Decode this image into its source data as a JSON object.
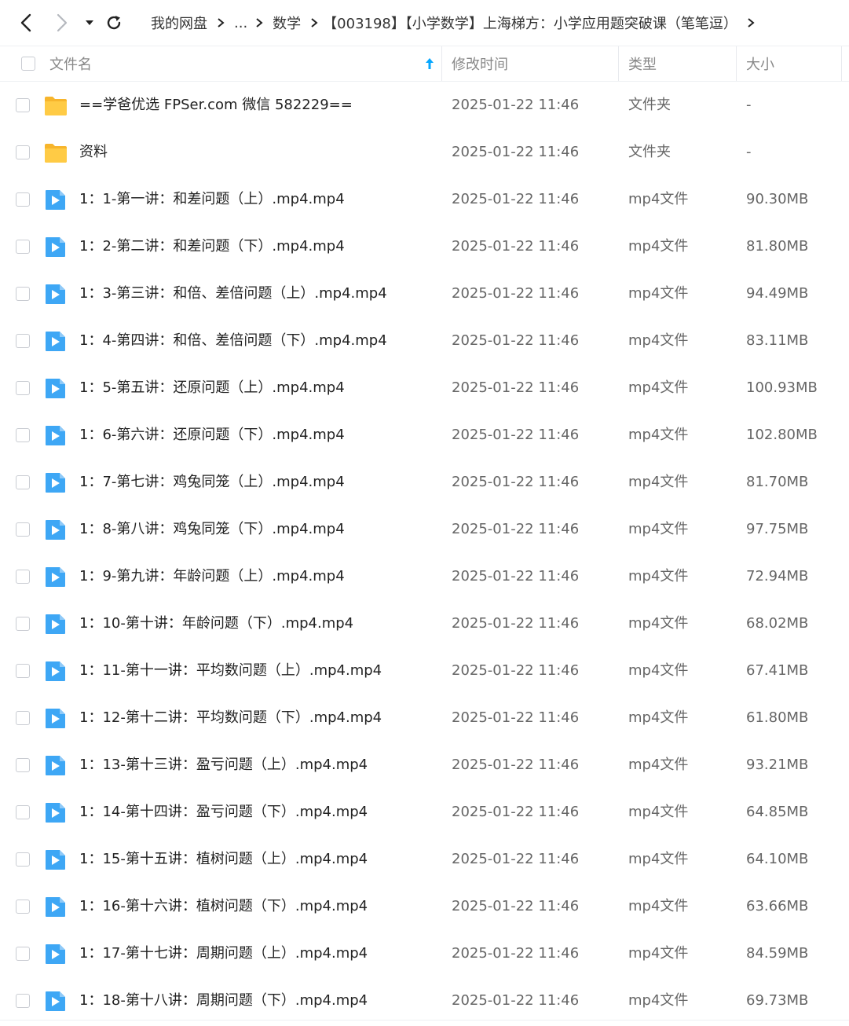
{
  "toolbar": {
    "breadcrumbs": [
      "我的网盘",
      "...",
      "数学",
      "【003198】【小学数学】上海梯方：小学应用题突破课（笔笔逗）"
    ]
  },
  "header": {
    "name": "文件名",
    "modified": "修改时间",
    "type": "类型",
    "size": "大小"
  },
  "files": [
    {
      "name": "==学爸优选 FPSer.com 微信 582229==",
      "modified": "2025-01-22 11:46",
      "type": "文件夹",
      "size": "-",
      "icon": "folder-icon"
    },
    {
      "name": "资料",
      "modified": "2025-01-22 11:46",
      "type": "文件夹",
      "size": "-",
      "icon": "folder-icon"
    },
    {
      "name": "1：1-第一讲：和差问题（上）.mp4.mp4",
      "modified": "2025-01-22 11:46",
      "type": "mp4文件",
      "size": "90.30MB",
      "icon": "video-file-icon"
    },
    {
      "name": "1：2-第二讲：和差问题（下）.mp4.mp4",
      "modified": "2025-01-22 11:46",
      "type": "mp4文件",
      "size": "81.80MB",
      "icon": "video-file-icon"
    },
    {
      "name": "1：3-第三讲：和倍、差倍问题（上）.mp4.mp4",
      "modified": "2025-01-22 11:46",
      "type": "mp4文件",
      "size": "94.49MB",
      "icon": "video-file-icon"
    },
    {
      "name": "1：4-第四讲：和倍、差倍问题（下）.mp4.mp4",
      "modified": "2025-01-22 11:46",
      "type": "mp4文件",
      "size": "83.11MB",
      "icon": "video-file-icon"
    },
    {
      "name": "1：5-第五讲：还原问题（上）.mp4.mp4",
      "modified": "2025-01-22 11:46",
      "type": "mp4文件",
      "size": "100.93MB",
      "icon": "video-file-icon"
    },
    {
      "name": "1：6-第六讲：还原问题（下）.mp4.mp4",
      "modified": "2025-01-22 11:46",
      "type": "mp4文件",
      "size": "102.80MB",
      "icon": "video-file-icon"
    },
    {
      "name": "1：7-第七讲：鸡兔同笼（上）.mp4.mp4",
      "modified": "2025-01-22 11:46",
      "type": "mp4文件",
      "size": "81.70MB",
      "icon": "video-file-icon"
    },
    {
      "name": "1：8-第八讲：鸡兔同笼（下）.mp4.mp4",
      "modified": "2025-01-22 11:46",
      "type": "mp4文件",
      "size": "97.75MB",
      "icon": "video-file-icon"
    },
    {
      "name": "1：9-第九讲：年龄问题（上）.mp4.mp4",
      "modified": "2025-01-22 11:46",
      "type": "mp4文件",
      "size": "72.94MB",
      "icon": "video-file-icon"
    },
    {
      "name": "1：10-第十讲：年龄问题（下）.mp4.mp4",
      "modified": "2025-01-22 11:46",
      "type": "mp4文件",
      "size": "68.02MB",
      "icon": "video-file-icon"
    },
    {
      "name": "1：11-第十一讲：平均数问题（上）.mp4.mp4",
      "modified": "2025-01-22 11:46",
      "type": "mp4文件",
      "size": "67.41MB",
      "icon": "video-file-icon"
    },
    {
      "name": "1：12-第十二讲：平均数问题（下）.mp4.mp4",
      "modified": "2025-01-22 11:46",
      "type": "mp4文件",
      "size": "61.80MB",
      "icon": "video-file-icon"
    },
    {
      "name": "1：13-第十三讲：盈亏问题（上）.mp4.mp4",
      "modified": "2025-01-22 11:46",
      "type": "mp4文件",
      "size": "93.21MB",
      "icon": "video-file-icon"
    },
    {
      "name": "1：14-第十四讲：盈亏问题（下）.mp4.mp4",
      "modified": "2025-01-22 11:46",
      "type": "mp4文件",
      "size": "64.85MB",
      "icon": "video-file-icon"
    },
    {
      "name": "1：15-第十五讲：植树问题（上）.mp4.mp4",
      "modified": "2025-01-22 11:46",
      "type": "mp4文件",
      "size": "64.10MB",
      "icon": "video-file-icon"
    },
    {
      "name": "1：16-第十六讲：植树问题（下）.mp4.mp4",
      "modified": "2025-01-22 11:46",
      "type": "mp4文件",
      "size": "63.66MB",
      "icon": "video-file-icon"
    },
    {
      "name": "1：17-第十七讲：周期问题（上）.mp4.mp4",
      "modified": "2025-01-22 11:46",
      "type": "mp4文件",
      "size": "84.59MB",
      "icon": "video-file-icon"
    },
    {
      "name": "1：18-第十八讲：周期问题（下）.mp4.mp4",
      "modified": "2025-01-22 11:46",
      "type": "mp4文件",
      "size": "69.73MB",
      "icon": "video-file-icon"
    }
  ],
  "colors": {
    "accent": "#06a7ff",
    "folder": "#ffc93c",
    "video_icon": "#3ea7f5",
    "text_primary": "#222222",
    "text_secondary": "#666666"
  }
}
